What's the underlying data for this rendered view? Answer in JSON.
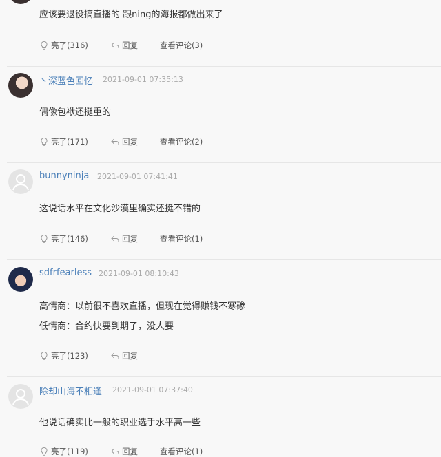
{
  "comments": [
    {
      "text": [
        "应该要退役搞直播的 跟ning的海报都做出来了"
      ],
      "like_label": "亮了(316)",
      "reply_label": "回复",
      "view_label": "查看评论(3)"
    },
    {
      "username": "丶深蓝色回忆",
      "time": "2021-09-01 07:35:13",
      "text": [
        "偶像包袱还挺重的"
      ],
      "like_label": "亮了(171)",
      "reply_label": "回复",
      "view_label": "查看评论(2)"
    },
    {
      "username": "bunnyninja",
      "time": "2021-09-01 07:41:41",
      "text": [
        "这说话水平在文化沙漠里确实还挺不错的"
      ],
      "like_label": "亮了(146)",
      "reply_label": "回复",
      "view_label": "查看评论(1)"
    },
    {
      "username": "sdfrfearless",
      "time": "2021-09-01 08:10:43",
      "text": [
        "高情商：以前很不喜欢直播，但现在觉得赚钱不寒碜",
        "低情商：合约快要到期了，没人要"
      ],
      "like_label": "亮了(123)",
      "reply_label": "回复"
    },
    {
      "username": "除却山海不相逢",
      "time": "2021-09-01 07:37:40",
      "text": [
        "他说话确实比一般的职业选手水平高一些"
      ],
      "like_label": "亮了(119)",
      "reply_label": "回复",
      "view_label": "查看评论(1)"
    }
  ],
  "colors": {
    "username": "#4a7fb8",
    "meta": "#aaaaaa",
    "text": "#333333",
    "background": "#f8f8f8"
  },
  "icons": {
    "like": "lightbulb-icon",
    "reply": "reply-arrow-icon",
    "avatar_default": "user-placeholder-icon"
  }
}
